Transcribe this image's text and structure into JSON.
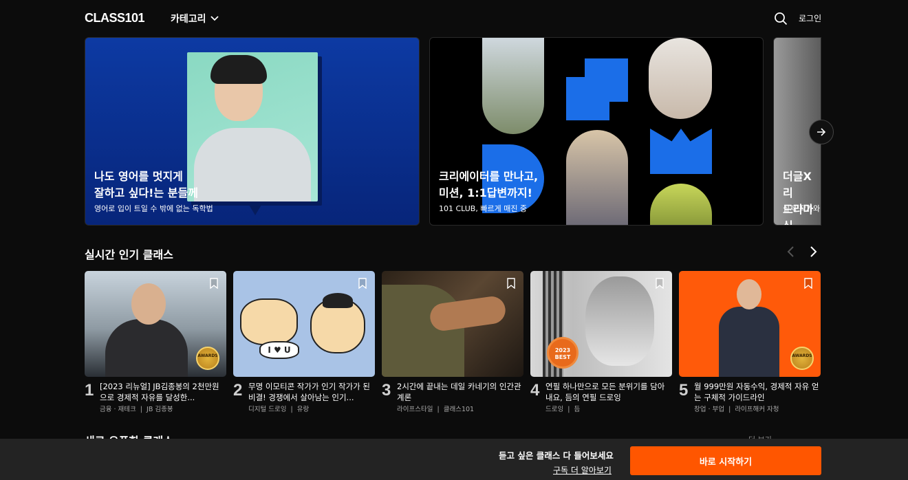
{
  "header": {
    "logo": "CLASS101",
    "category_label": "카테고리",
    "login_label": "로그인"
  },
  "banners": [
    {
      "title": "나도 영어를 멋지게\n잘하고 싶다!는 분들께",
      "subtitle": "영어로 입이 트일 수 밖에 없는 독학법"
    },
    {
      "title": "크리에이터를 만나고,\n미션, 1:1답변까지!",
      "subtitle": "101 CLUB, 빠르게 매진 중"
    },
    {
      "title": "더글X리\n드라마 싱",
      "subtitle": "실제 작가와"
    }
  ],
  "popular": {
    "title": "실시간 인기 클래스",
    "cards": [
      {
        "rank": "1",
        "title": "[2023 리뉴얼] JB김종봉의 2천만원으로 경제적 자유를 달성한...",
        "category": "금융 · 재테크",
        "creator": "JB 김종봉",
        "thumb_color": "#b9c7d2",
        "badge": "AWARDS"
      },
      {
        "rank": "2",
        "title": "무명 이모티콘 작가가 인기 작가가 된 비결! 경쟁에서 살아남는 인기...",
        "category": "디지털 드로잉",
        "creator": "유랑",
        "thumb_color": "#a9c3e6",
        "badge": ""
      },
      {
        "rank": "3",
        "title": "2시간에 끝내는 데일 카네기의 인간관계론",
        "category": "라이프스타일",
        "creator": "클래스101",
        "thumb_color": "#4a3a2a",
        "badge": ""
      },
      {
        "rank": "4",
        "title": "연필 하나만으로 모든 분위기를 담아내요, 듬의 연필 드로잉",
        "category": "드로잉",
        "creator": "듬",
        "thumb_color": "#c9c9c9",
        "badge": "2023 BEST"
      },
      {
        "rank": "5",
        "title": "월 999만원 자동수익, 경제적 자유 얻는 구체적 가이드라인",
        "category": "창업 · 부업",
        "creator": "라이프해커 자청",
        "thumb_color": "#ff5a0a",
        "badge": "AWARDS"
      }
    ]
  },
  "next_section": {
    "title": "새로 오픈한 클래스",
    "more_label": "더 보기"
  },
  "bottom_bar": {
    "prompt": "듣고 싶은 클래스 다 들어보세요",
    "link_label": "구독 더 알아보기",
    "button_label": "바로 시작하기"
  },
  "colors": {
    "accent": "#ff5600",
    "background": "#0c0c0c"
  }
}
